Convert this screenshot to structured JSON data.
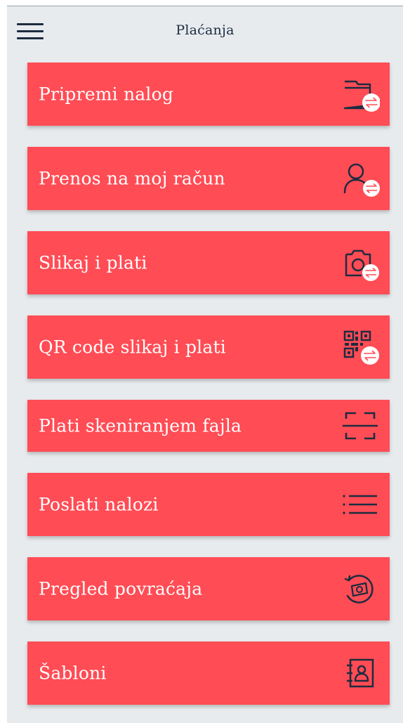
{
  "header": {
    "title": "Plaćanja",
    "menu_icon": "hamburger-menu-icon"
  },
  "colors": {
    "background": "#e8ebee",
    "item": "#ff4c55",
    "item_text": "#ffffff",
    "icon": "#1c2c40"
  },
  "menu": {
    "items": [
      {
        "label": "Pripremi nalog",
        "icon": "folder-transfer-icon"
      },
      {
        "label": "Prenos na moj račun",
        "icon": "person-transfer-icon"
      },
      {
        "label": "Slikaj i plati",
        "icon": "camera-transfer-icon"
      },
      {
        "label": "QR code slikaj i plati",
        "icon": "qr-transfer-icon"
      },
      {
        "label": "Plati skeniranjem fajla",
        "icon": "scan-icon"
      },
      {
        "label": "Poslati nalozi",
        "icon": "list-icon"
      },
      {
        "label": "Pregled povraćaja",
        "icon": "refund-icon"
      },
      {
        "label": "Šabloni",
        "icon": "address-book-icon"
      }
    ]
  }
}
